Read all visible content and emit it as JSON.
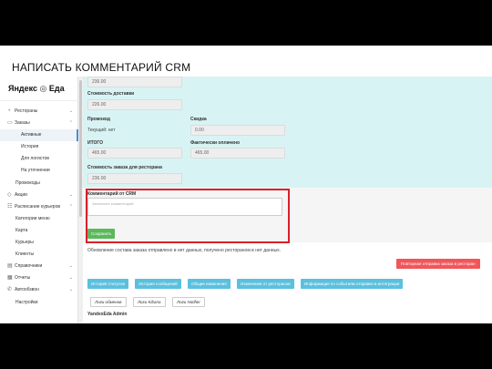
{
  "slide": {
    "title": "НАПИСАТЬ КОММЕНТАРИЙ CRM"
  },
  "sidebar": {
    "logo_text": "Яндекс",
    "logo_suffix": "Еда",
    "items": [
      {
        "label": "Рестораны",
        "icon": "restaurant-icon",
        "chevron": "⌄"
      },
      {
        "label": "Заказы",
        "icon": "orders-icon",
        "chevron": "⌃"
      },
      {
        "label": "Активные"
      },
      {
        "label": "История"
      },
      {
        "label": "Для логистов"
      },
      {
        "label": "На уточнении"
      },
      {
        "label": "Промокоды"
      },
      {
        "label": "Акции",
        "icon": "tag-icon",
        "chevron": "⌄"
      },
      {
        "label": "Расписание курьеров",
        "icon": "schedule-icon",
        "chevron": "⌃"
      },
      {
        "label": "Категории меню"
      },
      {
        "label": "Карта"
      },
      {
        "label": "Курьеры"
      },
      {
        "label": "Клиенты"
      },
      {
        "label": "Справочники",
        "icon": "book-icon",
        "chevron": "⌄"
      },
      {
        "label": "Отчеты",
        "icon": "report-icon",
        "chevron": "⌄"
      },
      {
        "label": "Автообзвон",
        "icon": "phone-icon",
        "chevron": "⌄"
      },
      {
        "label": "Настройки"
      }
    ]
  },
  "order": {
    "top_value": "236.00",
    "delivery_label": "Стоимость доставки",
    "delivery_value": "226.00",
    "promo_label": "Промокод",
    "promo_current": "Текущий: нет",
    "discount_label": "Скидка",
    "discount_value": "0.00",
    "total_label": "ИТОГО",
    "total_value": "465.00",
    "paid_label": "Фактически оплачено",
    "paid_value": "465.00",
    "restaurant_cost_label": "Стоимость заказа для ресторана",
    "restaurant_cost_value": "236.00"
  },
  "comment": {
    "label": "Комментарий от CRM",
    "placeholder": "Заполните комментарий",
    "save_label": "Сохранить"
  },
  "update_text": "Обновление состава заказа отправлено в нет данных, получено рестораном в нет данных.",
  "retry_button": "Повторная отправка заказа в ресторан",
  "action_buttons": [
    "История статусов",
    "История сообщений",
    "Общие изменения",
    "Изменения от ресторанов",
    "Информация по событиям отправки в интеграции"
  ],
  "log_buttons": [
    "Логи обменов",
    "Логи Kibana",
    "Логи Notifier"
  ],
  "footer_label": "YandexEda Admin",
  "colors": {
    "accent_cyan": "#d8f3f3",
    "save_green": "#5cb85c",
    "info_blue": "#5bc0de",
    "danger_red": "#f0565a",
    "highlight_red": "#d9202a"
  }
}
